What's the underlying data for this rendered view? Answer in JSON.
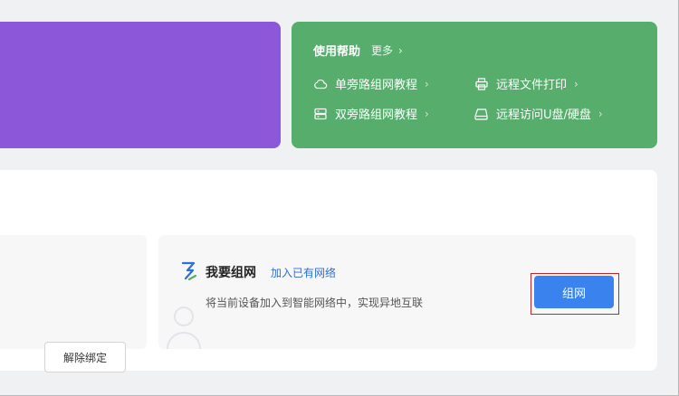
{
  "help": {
    "title": "使用帮助",
    "more": "更多",
    "links": [
      {
        "label": "单旁路组网教程",
        "icon": "cloud-icon"
      },
      {
        "label": "远程文件打印",
        "icon": "printer-icon"
      },
      {
        "label": "双旁路组网教程",
        "icon": "server-icon"
      },
      {
        "label": "远程访问U盘/硬盘",
        "icon": "drive-icon"
      }
    ]
  },
  "device": {
    "unbind_label": "解除绑定"
  },
  "network": {
    "title": "我要组网",
    "join_link": "加入已有网络",
    "description": "将当前设备加入到智能网络中，实现异地互联",
    "button_label": "组网"
  },
  "colors": {
    "purple_card": "#8c57d8",
    "help_card": "#56ad6c",
    "primary_button": "#3a82ee",
    "link": "#2f6fd6",
    "highlight": "#c6232b"
  }
}
